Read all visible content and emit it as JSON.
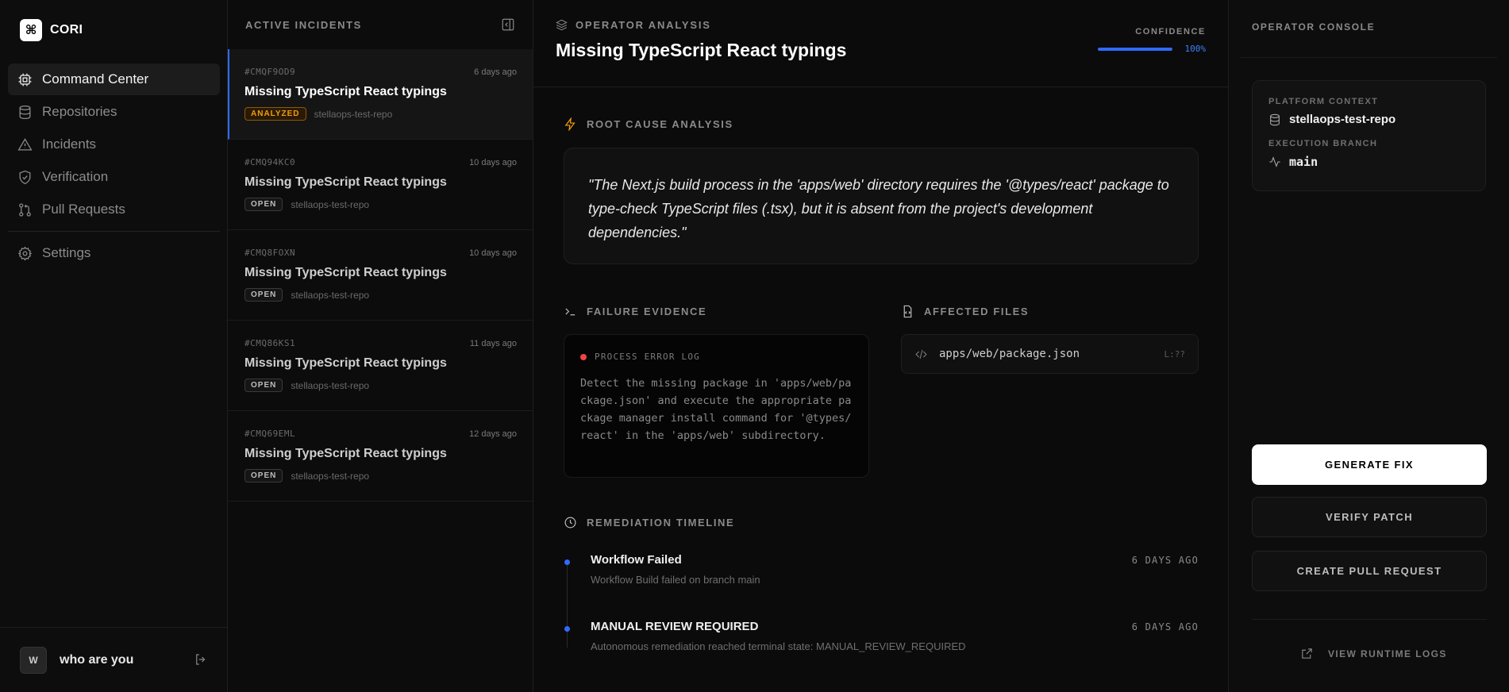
{
  "brand": {
    "logo": "⌘",
    "name": "CORI"
  },
  "nav": {
    "items": [
      {
        "label": "Command Center",
        "icon": "cpu-icon",
        "active": true
      },
      {
        "label": "Repositories",
        "icon": "database-icon"
      },
      {
        "label": "Incidents",
        "icon": "alert-triangle-icon"
      },
      {
        "label": "Verification",
        "icon": "shield-check-icon"
      },
      {
        "label": "Pull Requests",
        "icon": "git-pull-request-icon"
      }
    ],
    "settings": {
      "label": "Settings",
      "icon": "gear-icon"
    }
  },
  "user": {
    "initial": "W",
    "name": "who are you"
  },
  "incidents": {
    "title": "ACTIVE INCIDENTS",
    "items": [
      {
        "id": "#CMQF9OD9",
        "time": "6 days ago",
        "name": "Missing TypeScript React typings",
        "status": "ANALYZED",
        "repo": "stellaops-test-repo"
      },
      {
        "id": "#CMQ94KC0",
        "time": "10 days ago",
        "name": "Missing TypeScript React typings",
        "status": "OPEN",
        "repo": "stellaops-test-repo"
      },
      {
        "id": "#CMQ8FOXN",
        "time": "10 days ago",
        "name": "Missing TypeScript React typings",
        "status": "OPEN",
        "repo": "stellaops-test-repo"
      },
      {
        "id": "#CMQ86KS1",
        "time": "11 days ago",
        "name": "Missing TypeScript React typings",
        "status": "OPEN",
        "repo": "stellaops-test-repo"
      },
      {
        "id": "#CMQ69EML",
        "time": "12 days ago",
        "name": "Missing TypeScript React typings",
        "status": "OPEN",
        "repo": "stellaops-test-repo"
      }
    ]
  },
  "analysis": {
    "tag": "OPERATOR ANALYSIS",
    "title": "Missing TypeScript React typings",
    "confidence_label": "CONFIDENCE",
    "confidence_value": "100%",
    "confidence_fraction": 1.0,
    "root_cause_label": "ROOT CAUSE ANALYSIS",
    "root_cause_text": "\"The Next.js build process in the 'apps/web' directory requires the '@types/react' package to type-check TypeScript files (.tsx), but it is absent from the project's development dependencies.\"",
    "failure_evidence_label": "FAILURE EVIDENCE",
    "process_log_label": "PROCESS ERROR LOG",
    "process_log_text": "Detect the missing package in 'apps/web/package.json' and execute the appropriate package manager install command for '@types/react' in the 'apps/web' subdirectory.",
    "affected_files_label": "AFFECTED FILES",
    "files": [
      {
        "path": "apps/web/package.json",
        "line": "L:??"
      }
    ],
    "timeline_label": "REMEDIATION TIMELINE",
    "timeline": [
      {
        "title": "Workflow Failed",
        "desc": "Workflow Build failed on branch main",
        "time": "6 DAYS AGO"
      },
      {
        "title": "MANUAL REVIEW REQUIRED",
        "desc": "Autonomous remediation reached terminal state: MANUAL_REVIEW_REQUIRED",
        "time": "6 DAYS AGO"
      }
    ]
  },
  "console": {
    "title": "OPERATOR CONSOLE",
    "platform_label": "PLATFORM CONTEXT",
    "platform_value": "stellaops-test-repo",
    "branch_label": "EXECUTION BRANCH",
    "branch_value": "main",
    "generate_fix": "GENERATE FIX",
    "verify_patch": "VERIFY PATCH",
    "create_pr": "CREATE PULL REQUEST",
    "runtime_logs": "VIEW RUNTIME LOGS"
  },
  "colors": {
    "accent": "#2f6bff",
    "analyzed": "#f59e0b",
    "error": "#ef4444"
  }
}
